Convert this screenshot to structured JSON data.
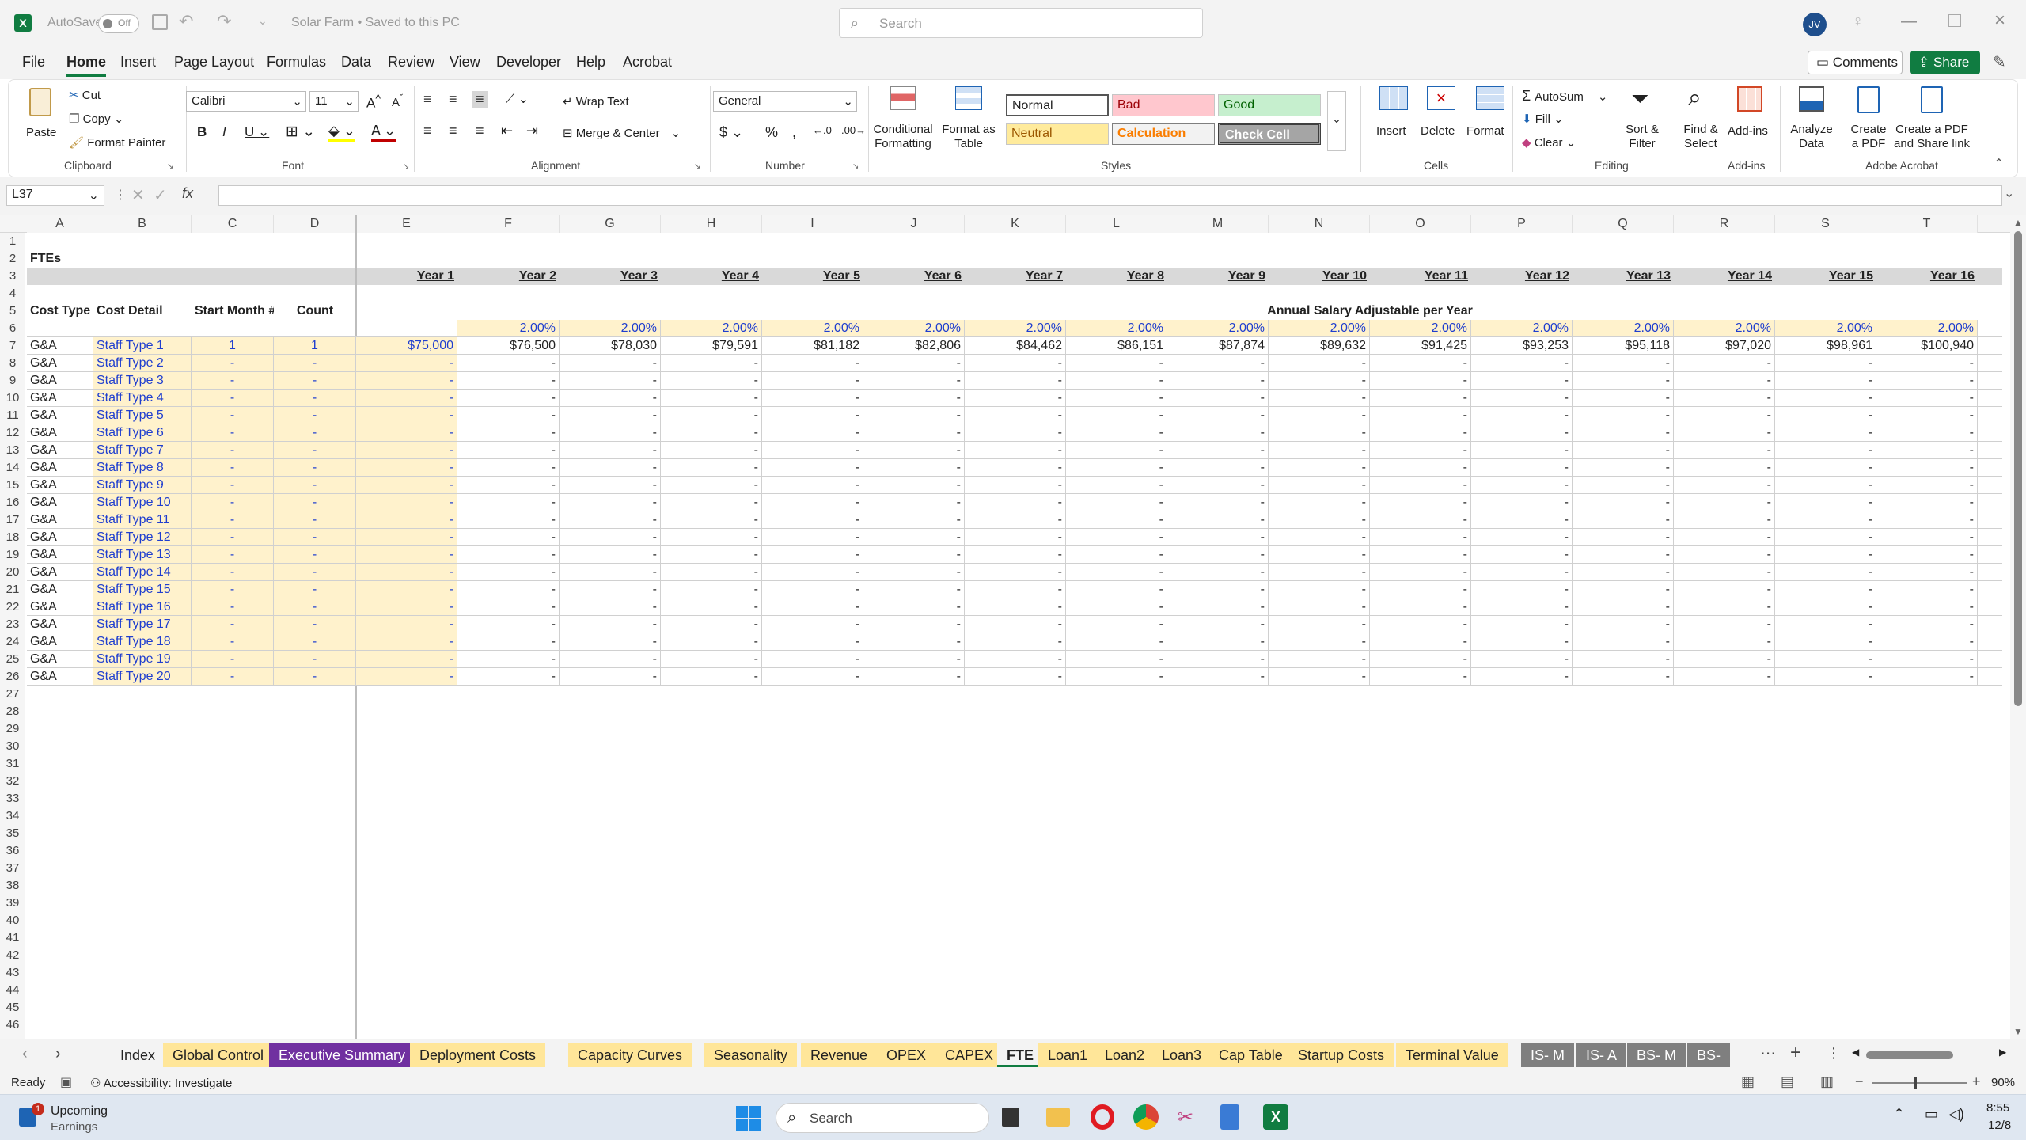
{
  "titlebar": {
    "autosave_label": "AutoSave",
    "autosave_state": "Off",
    "doc_title": "Solar Farm • Saved to this PC",
    "search_placeholder": "Search",
    "user_initials": "JV"
  },
  "menu": {
    "items": [
      "File",
      "Home",
      "Insert",
      "Page Layout",
      "Formulas",
      "Data",
      "Review",
      "View",
      "Developer",
      "Help",
      "Acrobat"
    ],
    "active": "Home",
    "comments_label": "Comments",
    "share_label": "Share"
  },
  "ribbon": {
    "clipboard": {
      "paste": "Paste",
      "cut": "Cut",
      "copy": "Copy",
      "format_painter": "Format Painter",
      "label": "Clipboard"
    },
    "font": {
      "name": "Calibri",
      "size": "11",
      "label": "Font"
    },
    "alignment": {
      "wrap": "Wrap Text",
      "merge": "Merge & Center",
      "label": "Alignment"
    },
    "number": {
      "format": "General",
      "label": "Number"
    },
    "styles": {
      "conditional": "Conditional Formatting",
      "format_table": "Format as Table",
      "cells": [
        {
          "label": "Normal"
        },
        {
          "label": "Bad"
        },
        {
          "label": "Good"
        },
        {
          "label": "Neutral"
        },
        {
          "label": "Calculation"
        },
        {
          "label": "Check Cell"
        }
      ],
      "label": "Styles"
    },
    "cells": {
      "insert": "Insert",
      "delete": "Delete",
      "format": "Format",
      "label": "Cells"
    },
    "editing": {
      "autosum": "AutoSum",
      "fill": "Fill",
      "clear": "Clear",
      "sort_filter": "Sort & Filter",
      "find_select": "Find & Select",
      "label": "Editing"
    },
    "addins": {
      "addins": "Add-ins",
      "label": "Add-ins"
    },
    "analyze": {
      "label": "Analyze Data"
    },
    "acrobat": {
      "create_pdf": "Create a PDF",
      "create_share": "Create a PDF and Share link",
      "label": "Adobe Acrobat"
    }
  },
  "formula": {
    "name_box": "L37",
    "fx": "fx",
    "content": ""
  },
  "grid": {
    "columns": [
      "A",
      "B",
      "C",
      "D",
      "E",
      "F",
      "G",
      "H",
      "I",
      "J",
      "K",
      "L",
      "M",
      "N",
      "O",
      "P",
      "Q",
      "R",
      "S",
      "T"
    ],
    "title": "FTEs",
    "years": [
      "Year 1",
      "Year 2",
      "Year 3",
      "Year 4",
      "Year 5",
      "Year 6",
      "Year 7",
      "Year 8",
      "Year 9",
      "Year 10",
      "Year 11",
      "Year 12",
      "Year 13",
      "Year 14",
      "Year 15",
      "Year 16"
    ],
    "headers": {
      "cost_type": "Cost Type",
      "cost_detail": "Cost Detail",
      "start_month": "Start Month #",
      "count": "Count",
      "annual": "Annual Salary Adjustable per Year"
    },
    "growth": "2.00%",
    "row7": {
      "type": "G&A",
      "detail": "Staff Type 1",
      "start": "1",
      "count": "1",
      "salaries": [
        "$75,000",
        "$76,500",
        "$78,030",
        "$79,591",
        "$81,182",
        "$82,806",
        "$84,462",
        "$86,151",
        "$87,874",
        "$89,632",
        "$91,425",
        "$93,253",
        "$95,118",
        "$97,020",
        "$98,961",
        "$100,940"
      ]
    },
    "dash": "-",
    "other_rows": [
      "Staff Type 2",
      "Staff Type 3",
      "Staff Type 4",
      "Staff Type 5",
      "Staff Type 6",
      "Staff Type 7",
      "Staff Type 8",
      "Staff Type 9",
      "Staff Type 10",
      "Staff Type 11",
      "Staff Type 12",
      "Staff Type 13",
      "Staff Type 14",
      "Staff Type 15",
      "Staff Type 16",
      "Staff Type 17",
      "Staff Type 18",
      "Staff Type 19",
      "Staff Type 20"
    ],
    "row_count": 46
  },
  "sheets": [
    {
      "label": "Index",
      "color": "#f3f3f3",
      "fg": "#222"
    },
    {
      "label": "Global Control",
      "color": "#ffe699",
      "fg": "#222"
    },
    {
      "label": "Executive Summary",
      "color": "#7030a0",
      "fg": "#fff"
    },
    {
      "label": "Deployment Costs",
      "color": "#ffe699",
      "fg": "#222"
    },
    {
      "label": "Capacity Curves",
      "color": "#ffe699",
      "fg": "#222"
    },
    {
      "label": "Seasonality",
      "color": "#ffe699",
      "fg": "#222"
    },
    {
      "label": "Revenue",
      "color": "#ffe699",
      "fg": "#222"
    },
    {
      "label": "OPEX",
      "color": "#ffe699",
      "fg": "#222"
    },
    {
      "label": "CAPEX",
      "color": "#ffe699",
      "fg": "#222"
    },
    {
      "label": "FTE",
      "color": "#ffffff",
      "fg": "#222"
    },
    {
      "label": "Loan1",
      "color": "#ffe699",
      "fg": "#222"
    },
    {
      "label": "Loan2",
      "color": "#ffe699",
      "fg": "#222"
    },
    {
      "label": "Loan3",
      "color": "#ffe699",
      "fg": "#222"
    },
    {
      "label": "Cap Table",
      "color": "#ffe699",
      "fg": "#222"
    },
    {
      "label": "Startup Costs",
      "color": "#ffe699",
      "fg": "#222"
    },
    {
      "label": "Terminal Value",
      "color": "#ffe699",
      "fg": "#222"
    },
    {
      "label": "IS- M",
      "color": "#7f7f7f",
      "fg": "#fff"
    },
    {
      "label": "IS- A",
      "color": "#7f7f7f",
      "fg": "#fff"
    },
    {
      "label": "BS- M",
      "color": "#7f7f7f",
      "fg": "#fff"
    },
    {
      "label": "BS-",
      "color": "#7f7f7f",
      "fg": "#fff"
    }
  ],
  "status": {
    "ready": "Ready",
    "accessibility": "Accessibility: Investigate",
    "zoom": "90%"
  },
  "taskbar": {
    "news_title": "Upcoming",
    "news_sub": "Earnings",
    "badge": "1",
    "search": "Search",
    "time": "8:55",
    "date": "12/8"
  }
}
